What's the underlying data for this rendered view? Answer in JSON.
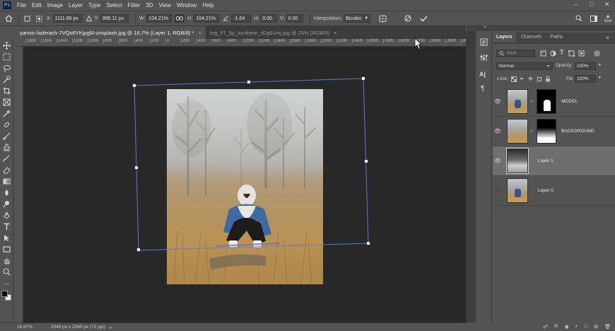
{
  "app": {
    "logo": "Ps"
  },
  "menu": [
    "File",
    "Edit",
    "Image",
    "Layer",
    "Type",
    "Select",
    "Filter",
    "3D",
    "View",
    "Window",
    "Help"
  ],
  "window_controls": {
    "minimize": "–",
    "maximize": "□",
    "close": "✕"
  },
  "options": {
    "x_label": "X:",
    "x_value": "1111.68 px",
    "y_label": "Y:",
    "y_value": "996.11 px",
    "w_label": "W:",
    "w_value": "104.21%",
    "h_label": "H:",
    "h_value": "104.21%",
    "angle_value": "-1.64",
    "hskew_label": "H:",
    "hskew_value": "0.00",
    "vskew_label": "V:",
    "vskew_value": "0.00",
    "interp_label": "Interpolation:",
    "interp_value": "Bicubic"
  },
  "tabs": [
    {
      "label": "yannic-laderach-7VQo6YKjpgM-unsplash.jpg @ 16,7% (Layer 1, RGB/8) *",
      "close": "×"
    },
    {
      "label": "fog_57_by_lumibear_d2g61mj.jpg @ 25% (RGB/8)",
      "close": "×"
    }
  ],
  "ruler_labels": [
    "1800",
    "1600",
    "1400",
    "1200",
    "1000",
    "800",
    "600",
    "400",
    "200",
    "0",
    "200",
    "400",
    "600",
    "800",
    "1000",
    "1200",
    "1400",
    "1600",
    "1800",
    "2000",
    "2200",
    "2400",
    "2600",
    "2800",
    "3000",
    "3200",
    "3400",
    "3600",
    "3800",
    "4000"
  ],
  "status": {
    "zoom": "16.67%",
    "doc_info": "2048 px x 2560 px (72 ppi)"
  },
  "panel": {
    "tabs": [
      "Layers",
      "Channels",
      "Paths"
    ],
    "search_placeholder": "Kind",
    "blend_mode": "Normal",
    "opacity_label": "Opacity:",
    "opacity_value": "100%",
    "lock_label": "Lock:",
    "fill_label": "Fill:",
    "fill_value": "100%",
    "layers": [
      {
        "name": "MODEL",
        "visible": true,
        "selected": false
      },
      {
        "name": "BACKGROUND",
        "visible": true,
        "selected": false
      },
      {
        "name": "Layer 1",
        "visible": true,
        "selected": true
      },
      {
        "name": "Layer 0",
        "visible": false,
        "selected": false
      }
    ]
  },
  "colors": {
    "accent": "#31a8ff",
    "transform_box": "#5a7bd8",
    "canvas": "#282828",
    "ui": "#535353"
  }
}
